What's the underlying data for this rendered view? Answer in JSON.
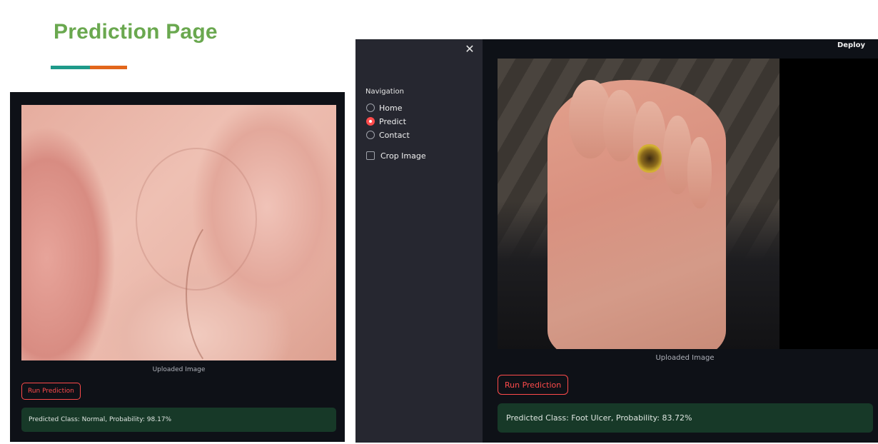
{
  "page": {
    "title": "Prediction Page",
    "accent_colors": [
      "#1f9a8a",
      "#e2661b"
    ],
    "title_color": "#6aa84f"
  },
  "left_screenshot": {
    "image_caption": "Uploaded Image",
    "run_button_label": "Run Prediction",
    "result_text": "Predicted Class: Normal, Probability: 98.17%"
  },
  "right_screenshot": {
    "sidebar": {
      "close_icon": "close-icon",
      "close_glyph": "✕",
      "navigation_label": "Navigation",
      "nav_options": [
        {
          "label": "Home",
          "selected": false
        },
        {
          "label": "Predict",
          "selected": true
        },
        {
          "label": "Contact",
          "selected": false
        }
      ],
      "crop_checkbox_label": "Crop Image",
      "crop_checked": false
    },
    "header": {
      "deploy_label": "Deploy"
    },
    "image_caption": "Uploaded Image",
    "run_button_label": "Run Prediction",
    "result_text": "Predicted Class: Foot Ulcer, Probability: 83.72%"
  },
  "colors": {
    "app_background": "#0e1117",
    "sidebar_background": "#262730",
    "primary_red": "#ff4b4b",
    "success_background": "#173928"
  }
}
